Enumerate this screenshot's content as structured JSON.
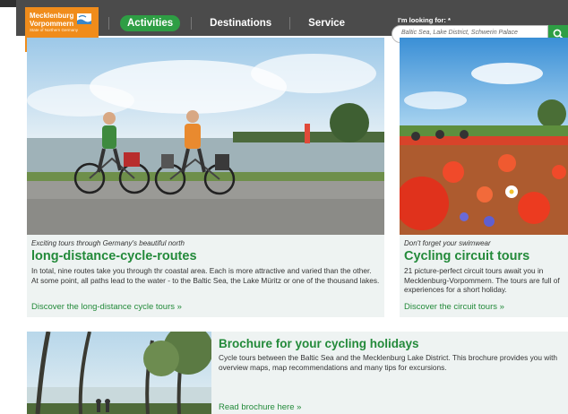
{
  "header": {
    "logo": {
      "line1": "Mecklenburg",
      "line2": "Vorpommern",
      "tagline": "State of Northern Germany"
    },
    "nav": [
      {
        "label": "Activities"
      },
      {
        "label": "Destinations"
      },
      {
        "label": "Service"
      }
    ],
    "search": {
      "label": "I'm looking for: *",
      "placeholder": "Baltic Sea, Lake District, Schwerin Palace"
    }
  },
  "cards": {
    "longdistance": {
      "kicker": "Exciting tours through Germany's beautiful north",
      "title": "long-distance-cycle-routes",
      "description": "In total, nine routes take you through thr coastal area. Each is more attractive and varied than the other. At some point, all paths lead to the water - to the Baltic Sea, the Lake Müritz or one of the thousand lakes.",
      "link": "Discover the long-distance cycle tours »"
    },
    "circuit": {
      "kicker": "Don't forget your swimwear",
      "title": "Cycling circuit tours",
      "description": "21 picture-perfect circuit tours await you in Mecklenburg-Vorpommern. The tours are full of experiences for a short holiday.",
      "link": "Discover the circuit tours »"
    },
    "brochure": {
      "title": "Brochure for your cycling holidays",
      "description": "Cycle tours between the Baltic Sea and the Mecklenburg Lake District. This brochure provides you with overview maps, map recommendations and many tips for excursions.",
      "link": "Read brochure here »"
    }
  },
  "colors": {
    "accent_green": "#2e9e44",
    "logo_orange": "#f08c1b",
    "header_gray": "#4b4b4b",
    "card_bg": "#eef3f2"
  }
}
